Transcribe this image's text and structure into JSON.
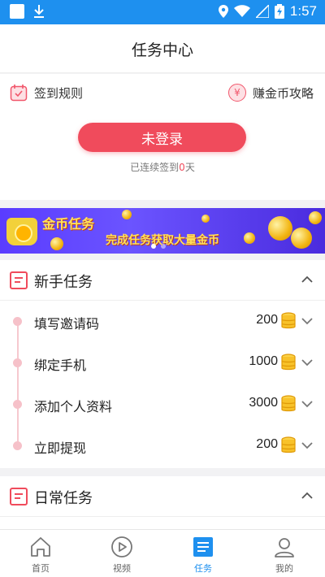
{
  "statusbar": {
    "time": "1:57"
  },
  "header": {
    "title": "任务中心"
  },
  "signin": {
    "rules_label": "签到规则",
    "guide_label": "赚金币攻略",
    "yen_symbol": "¥",
    "login_button": "未登录",
    "streak_prefix": "已连续签到",
    "streak_days": "0",
    "streak_suffix": "天"
  },
  "banner": {
    "title": "金币任务",
    "subtitle": "完成任务获取大量金币"
  },
  "sections": [
    {
      "title": "新手任务",
      "expanded": true,
      "tasks": [
        {
          "name": "填写邀请码",
          "reward": "200"
        },
        {
          "name": "绑定手机",
          "reward": "1000"
        },
        {
          "name": "添加个人资料",
          "reward": "3000"
        },
        {
          "name": "立即提现",
          "reward": "200"
        }
      ]
    },
    {
      "title": "日常任务",
      "expanded": true,
      "tasks": []
    }
  ],
  "bottomnav": {
    "items": [
      {
        "label": "首页",
        "icon": "home-icon",
        "active": false
      },
      {
        "label": "视频",
        "icon": "play-icon",
        "active": false
      },
      {
        "label": "任务",
        "icon": "task-list-icon",
        "active": true
      },
      {
        "label": "我的",
        "icon": "profile-icon",
        "active": false
      }
    ]
  },
  "colors": {
    "primary_blue": "#1e90ef",
    "accent_red": "#f04b5c",
    "banner_purple": "#5a3cff",
    "coin_gold": "#f2b410"
  }
}
